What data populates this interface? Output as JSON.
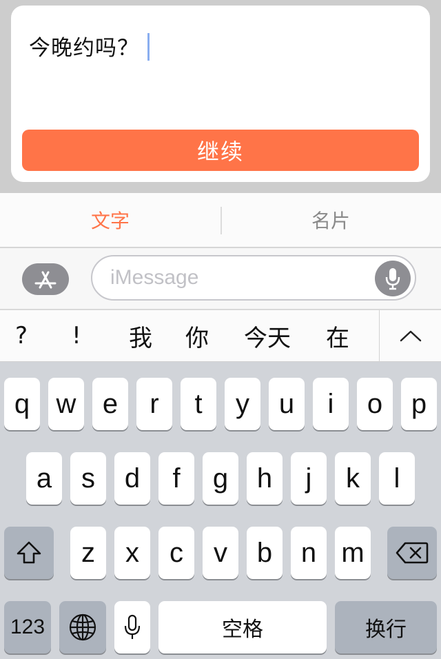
{
  "compose": {
    "message": "今晚约吗？",
    "continue_label": "继续"
  },
  "tabs": [
    {
      "label": "文字",
      "active": true
    },
    {
      "label": "名片",
      "active": false
    }
  ],
  "imessage": {
    "placeholder": "iMessage",
    "appstore_icon": "app-store-icon",
    "mic_icon": "microphone-icon"
  },
  "candidates": [
    "?",
    "!",
    "我",
    "你",
    "今天",
    "在"
  ],
  "keyboard": {
    "row1": [
      "q",
      "w",
      "e",
      "r",
      "t",
      "y",
      "u",
      "i",
      "o",
      "p"
    ],
    "row2": [
      "a",
      "s",
      "d",
      "f",
      "g",
      "h",
      "j",
      "k",
      "l"
    ],
    "row3": [
      "z",
      "x",
      "c",
      "v",
      "b",
      "n",
      "m"
    ],
    "numbers_label": "123",
    "space_label": "空格",
    "return_label": "换行"
  },
  "colors": {
    "accent": "#ff7448",
    "key_dark": "#acb3bd",
    "keyboard_bg": "#d1d4d9"
  }
}
